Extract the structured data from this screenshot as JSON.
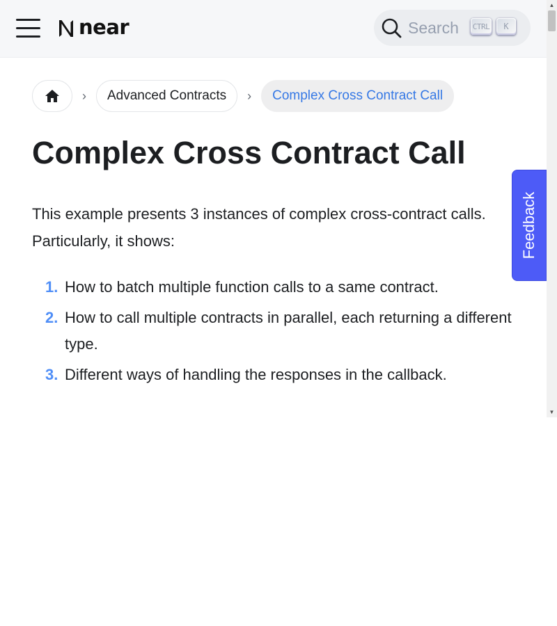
{
  "navbar": {
    "brand": "near",
    "search_placeholder": "Search",
    "kbd_ctrl": "CTRL",
    "kbd_k": "K"
  },
  "breadcrumbs": [
    {
      "label": "",
      "icon": "home-icon"
    },
    {
      "label": "Advanced Contracts"
    },
    {
      "label": "Complex Cross Contract Call"
    }
  ],
  "page": {
    "title": "Complex Cross Contract Call",
    "intro": "This example presents 3 instances of complex cross-contract calls. Particularly, it shows:",
    "list": [
      {
        "num": "1.",
        "text": "How to batch multiple function calls to a same contract."
      },
      {
        "num": "2.",
        "text": "How to call multiple contracts in parallel, each returning a different type."
      },
      {
        "num": "3.",
        "text": "Different ways of handling the responses in the callback."
      }
    ]
  },
  "feedback_label": "Feedback",
  "colors": {
    "accent": "#3578e5",
    "list_number": "#4f8ef7",
    "feedback_bg": "#4d5bf7",
    "navbar_bg": "#f6f7f9"
  }
}
